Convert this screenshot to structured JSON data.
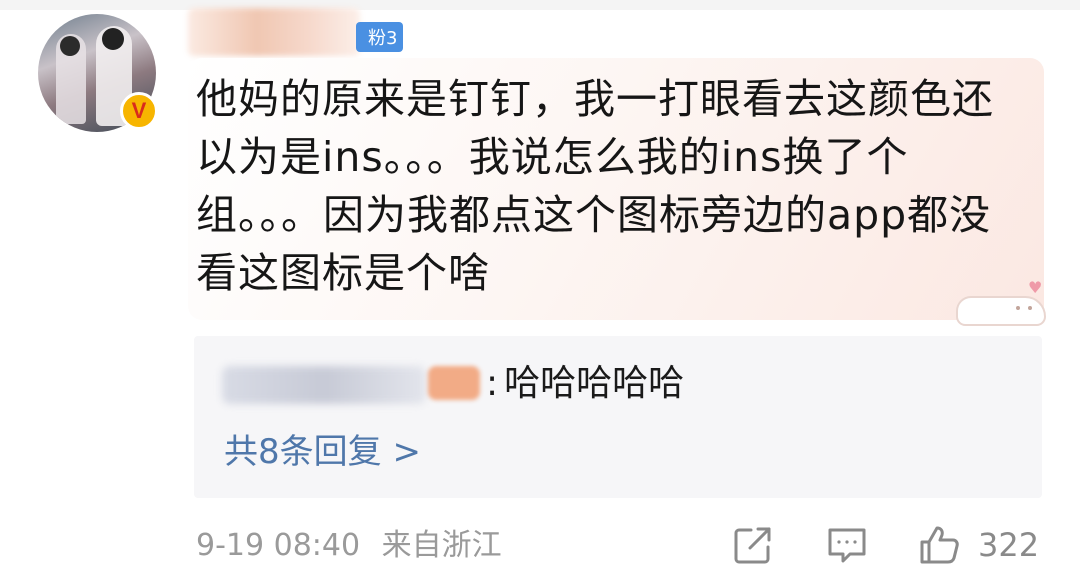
{
  "user": {
    "fan_badge_label": "粉3",
    "verified_icon_glyph": "V"
  },
  "comment": {
    "text": "他妈的原来是钉钉，我一打眼看去这颜色还以为是ins。。。我说怎么我的ins换了个组。。。因为我都点这个图标旁边的app都没看这图标是个啥"
  },
  "reply_preview": {
    "colon": ":",
    "text": "哈哈哈哈哈",
    "more_label": "共8条回复 >"
  },
  "meta": {
    "timestamp": "9-19 08:40",
    "location": "来自浙江"
  },
  "actions": {
    "share_icon": "share-icon",
    "comment_icon": "comment-icon",
    "like_icon": "like-icon",
    "like_count": "322"
  },
  "colors": {
    "fan_badge": "#4a90e2",
    "link": "#4f77aa",
    "meta_text": "#9a9a9a",
    "verified_badge": "#f7b500"
  }
}
